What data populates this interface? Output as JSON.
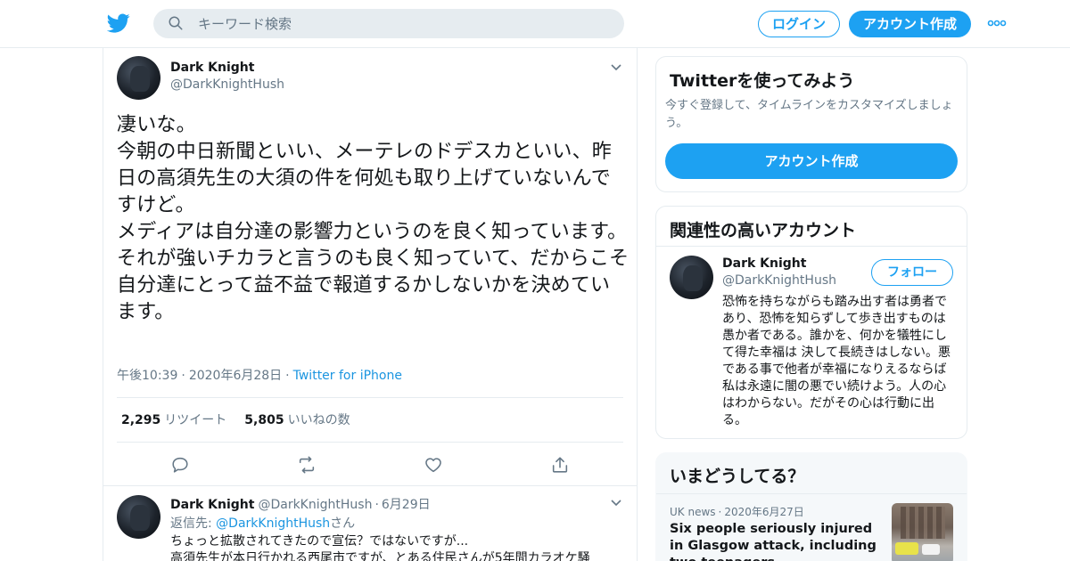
{
  "header": {
    "search_placeholder": "キーワード検索",
    "login_label": "ログイン",
    "signup_label": "アカウント作成",
    "brand_color": "#1da1f2"
  },
  "tweet": {
    "name": "Dark Knight",
    "handle": "@DarkKnightHush",
    "text": "凄いな。\n今朝の中日新聞といい、メーテレのドデスカといい、昨日の高須先生の大須の件を何処も取り上げていないんですけど。\nメディアは自分達の影響力というのを良く知っています。\nそれが強いチカラと言うのも良く知っていて、だからこそ自分達にとって益不益で報道するかしないかを決めています。",
    "time": "午後10:39",
    "date": "2020年6月28日",
    "source": "Twitter for iPhone",
    "retweets_count": "2,295",
    "retweets_label": "リツイート",
    "likes_count": "5,805",
    "likes_label": "いいねの数"
  },
  "reply": {
    "name": "Dark Knight",
    "handle": "@DarkKnightHush",
    "date": "6月29日",
    "reply_prefix": "返信先: ",
    "reply_to": "@DarkKnightHush",
    "reply_suffix": "さん",
    "text": "ちょっと拡散されてきたので宣伝？ではないですが...\n高須先生が本日行かれる西尾市ですが、とある住民さんが5年間カラオケ騒"
  },
  "signup_card": {
    "title": "Twitterを使ってみよう",
    "subtitle": "今すぐ登録して、タイムラインをカスタマイズしましょう。",
    "cta_label": "アカウント作成"
  },
  "related_card": {
    "title": "関連性の高いアカウント",
    "name": "Dark Knight",
    "handle": "@DarkKnightHush",
    "follow_label": "フォロー",
    "bio": "恐怖を持ちながらも踏み出す者は勇者であり、恐怖を知らずして歩き出すものは愚か者である。誰かを、何かを犠牲にして得た幸福は 決して長続きはしない。悪である事で他者が幸福になりえるならば 私は永遠に闇の悪でい続けよう。人の心はわからない。だがその心は行動に出る。"
  },
  "trends_card": {
    "title": "いまどうしてる？",
    "category": "UK news",
    "date": "2020年6月27日",
    "headline": "Six people seriously injured in Glasgow attack, including two teenagers"
  },
  "icons": [
    "twitter-bird-icon",
    "search-icon",
    "more-dots-icon",
    "chevron-down-icon",
    "reply-icon",
    "retweet-icon",
    "like-heart-icon",
    "share-icon"
  ]
}
